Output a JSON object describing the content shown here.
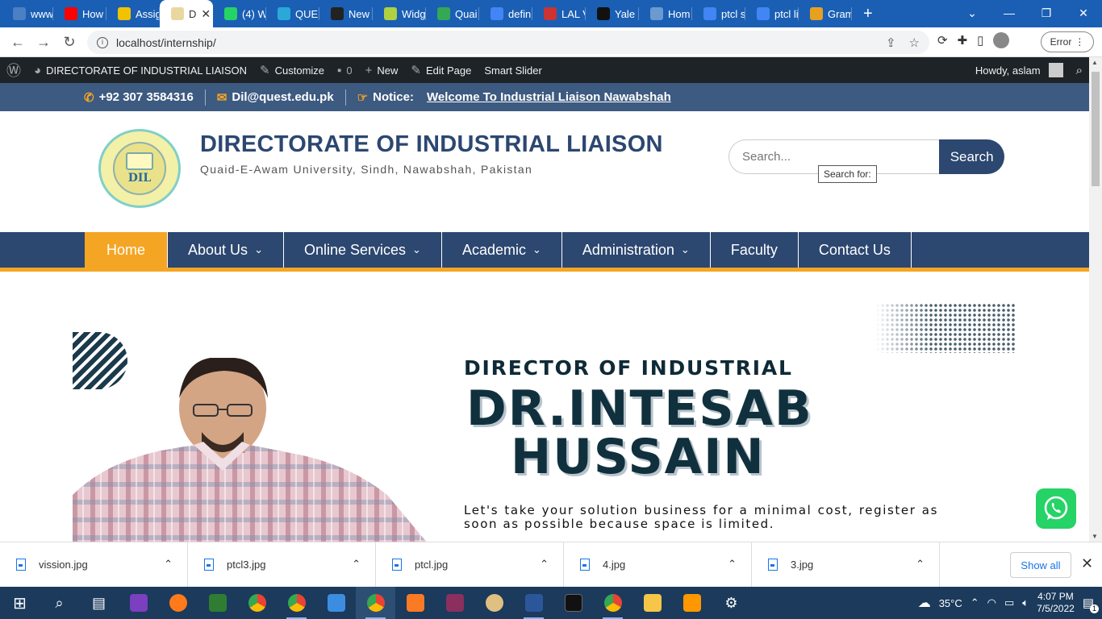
{
  "browser": {
    "tabs": [
      {
        "label": "www",
        "color": "#4d7fc4"
      },
      {
        "label": "How",
        "color": "#ff0000"
      },
      {
        "label": "Assig",
        "color": "#f2c200"
      },
      {
        "label": "D",
        "color": "#e8d8a0",
        "active": true
      },
      {
        "label": "(4) W",
        "color": "#25d366"
      },
      {
        "label": "QUES",
        "color": "#2aa8d8"
      },
      {
        "label": "New",
        "color": "#222222"
      },
      {
        "label": "Widg",
        "color": "#b0d040"
      },
      {
        "label": "Quai",
        "color": "#34a853"
      },
      {
        "label": "defin",
        "color": "#4285f4"
      },
      {
        "label": "LAL V",
        "color": "#cc3333"
      },
      {
        "label": "Yale S",
        "color": "#111111"
      },
      {
        "label": "Hom",
        "color": "#6a9ad0"
      },
      {
        "label": "ptcl s",
        "color": "#4285f4"
      },
      {
        "label": "ptcl li",
        "color": "#4285f4"
      },
      {
        "label": "Gram",
        "color": "#e8a020"
      }
    ],
    "url": "localhost/internship/",
    "error_label": "Error"
  },
  "wp_admin": {
    "site_name": "DIRECTORATE OF INDUSTRIAL LIAISON",
    "customize": "Customize",
    "comments": "0",
    "new": "New",
    "edit_page": "Edit Page",
    "smart_slider": "Smart Slider",
    "howdy": "Howdy, aslam"
  },
  "infobar": {
    "phone": "+92 307 3584316",
    "email": "Dil@quest.edu.pk",
    "notice_label": "Notice:",
    "notice_text": "Welcome To Industrial Liaison Nawabshah"
  },
  "header": {
    "title": "DIRECTORATE OF INDUSTRIAL LIAISON",
    "subtitle": "Quaid-E-Awam University, Sindh, Nawabshah, Pakistan",
    "logo_text": "DIL",
    "search_placeholder": "Search...",
    "search_button": "Search",
    "tooltip": "Search for:"
  },
  "nav": [
    {
      "label": "Home",
      "active": true,
      "dropdown": false
    },
    {
      "label": "About Us",
      "dropdown": true
    },
    {
      "label": "Online Services",
      "dropdown": true
    },
    {
      "label": "Academic",
      "dropdown": true
    },
    {
      "label": "Administration",
      "dropdown": true
    },
    {
      "label": "Faculty",
      "dropdown": false
    },
    {
      "label": "Contact Us",
      "dropdown": false
    }
  ],
  "slider": {
    "kicker": "DIRECTOR OF INDUSTRIAL",
    "name_line1": "DR.INTESAB",
    "name_line2": "HUSSAIN",
    "description": "Let's take your solution business for a minimal cost, register as soon as possible because space is limited."
  },
  "downloads": {
    "files": [
      "vission.jpg",
      "ptcl3.jpg",
      "ptcl.jpg",
      "4.jpg",
      "3.jpg"
    ],
    "show_all": "Show all"
  },
  "taskbar": {
    "weather": "35°C",
    "time": "4:07 PM",
    "date": "7/5/2022",
    "notifications": "1"
  }
}
